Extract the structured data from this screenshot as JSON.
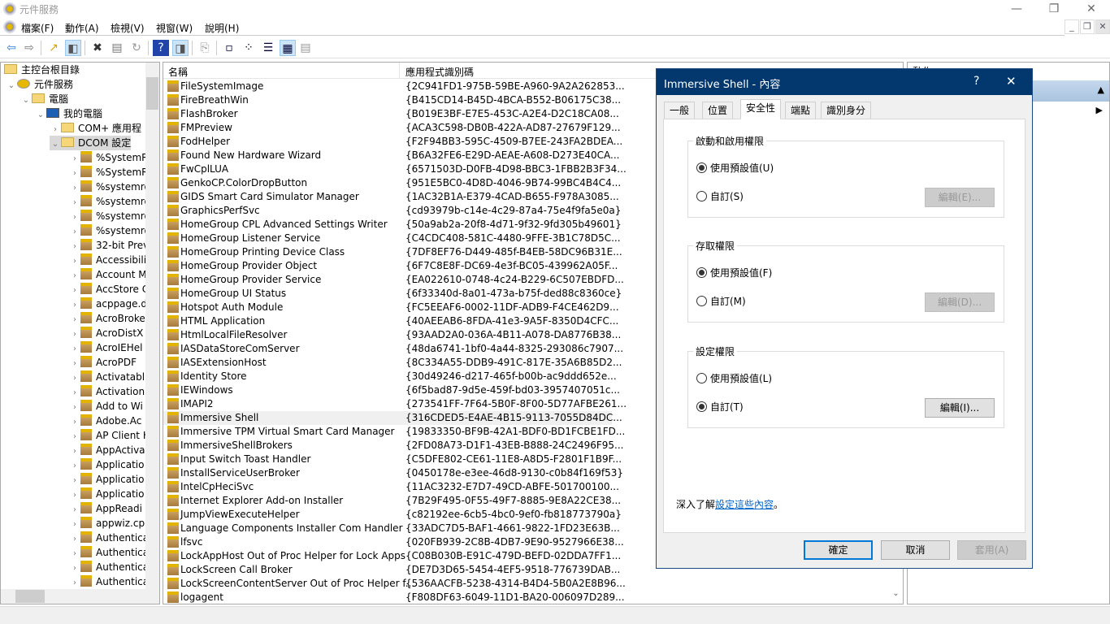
{
  "window": {
    "title": "元件服務",
    "minimize": "—",
    "maximize": "❐",
    "close": "✕"
  },
  "menu": [
    "檔案(F)",
    "動作(A)",
    "檢視(V)",
    "視窗(W)",
    "說明(H)"
  ],
  "mdi": {
    "minimize": "_",
    "restore": "❐",
    "close": "✕"
  },
  "toolbar": [
    {
      "icon": "back-arrow-icon",
      "glyph": "⇦",
      "color": "#2b7cd3"
    },
    {
      "icon": "forward-arrow-icon",
      "glyph": "⇨",
      "color": "#777"
    },
    {
      "icon": "up-folder-icon",
      "glyph": "↗",
      "color": "#d9a400"
    },
    {
      "icon": "show-hide-tree-icon",
      "glyph": "◧",
      "color": "#555",
      "active": true
    },
    {
      "icon": "delete-icon",
      "glyph": "✖",
      "color": "#333"
    },
    {
      "icon": "properties-icon",
      "glyph": "▤",
      "color": "#777"
    },
    {
      "icon": "refresh-icon",
      "glyph": "↻",
      "color": "#999"
    },
    {
      "icon": "help-icon",
      "glyph": "?",
      "color": "#fff",
      "bg": "#2244aa"
    },
    {
      "icon": "show-action-pane-icon",
      "glyph": "◨",
      "color": "#555",
      "active": true
    },
    {
      "icon": "export-icon",
      "glyph": "⎘",
      "color": "#999"
    },
    {
      "icon": "large-icons-view-icon",
      "glyph": "▫",
      "color": "#003"
    },
    {
      "icon": "small-icons-view-icon",
      "glyph": "⁘",
      "color": "#003"
    },
    {
      "icon": "list-view-icon",
      "glyph": "☰",
      "color": "#003"
    },
    {
      "icon": "detail-view-icon",
      "glyph": "▦",
      "color": "#003",
      "active": true
    },
    {
      "icon": "status-view-icon",
      "glyph": "▤",
      "color": "#999"
    }
  ],
  "tree": {
    "root": "主控台根目錄",
    "nodes": [
      {
        "label": "元件服務",
        "level": 1,
        "type": "app",
        "expanded": true
      },
      {
        "label": "電腦",
        "level": 2,
        "type": "folder",
        "expanded": true
      },
      {
        "label": "我的電腦",
        "level": 3,
        "type": "computer",
        "expanded": true
      },
      {
        "label": "COM+ 應用程",
        "level": 4,
        "type": "folder"
      },
      {
        "label": "DCOM 設定",
        "level": 4,
        "type": "folder",
        "expanded": true,
        "selected": true
      }
    ],
    "items": [
      "%SystemR",
      "%SystemR",
      "%systemro",
      "%systemro",
      "%systemro",
      "%systemro",
      "32-bit Prev",
      "Accessibili",
      "Account M",
      "AccStore C",
      "acppage.d",
      "AcroBroke",
      "AcroDistX",
      "AcroIEHel",
      "AcroPDF",
      "Activatabl",
      "Activation",
      "Add to Wi",
      "Adobe.Ac",
      "AP Client H",
      "AppActiva",
      "Applicatio",
      "Applicatio",
      "Applicatio",
      "AppReadi",
      "appwiz.cp",
      "Authentica",
      "Authentica",
      "Authentica",
      "Authentica"
    ]
  },
  "list": {
    "columns": [
      "名稱",
      "應用程式識別碼"
    ],
    "rows": [
      [
        "FileSystemImage",
        "{2C941FD1-975B-59BE-A960-9A2A262853..."
      ],
      [
        "FireBreathWin",
        "{B415CD14-B45D-4BCA-B552-B06175C38..."
      ],
      [
        "FlashBroker",
        "{B019E3BF-E7E5-453C-A2E4-D2C18CA08..."
      ],
      [
        "FMPreview",
        "{ACA3C598-DB0B-422A-AD87-27679F129..."
      ],
      [
        "FodHelper",
        "{F2F94BB3-595C-4509-B7EE-243FA2BDEA..."
      ],
      [
        "Found New Hardware Wizard",
        "{B6A32FE6-E29D-AEAE-A608-D273E40CA..."
      ],
      [
        "FwCplLUA",
        "{6571503D-D0FB-4D98-BBC3-1FBB2B3F34..."
      ],
      [
        "GenkoCP.ColorDropButton",
        "{951E5BC0-4D8D-4046-9B74-99BC4B4C4..."
      ],
      [
        "GIDS Smart Card Simulator Manager",
        "{1AC32B1A-E379-4CAD-B655-F978A3085..."
      ],
      [
        "GraphicsPerfSvc",
        "{cd93979b-c14e-4c29-87a4-75e4f9fa5e0a}"
      ],
      [
        "HomeGroup CPL Advanced Settings Writer",
        "{50a9ab2a-20f8-4d71-9f32-9fd305b49601}"
      ],
      [
        "HomeGroup Listener Service",
        "{C4CDC408-581C-4480-9FFE-3B1C78D5C..."
      ],
      [
        "HomeGroup Printing Device Class",
        "{7DF8EF76-D449-485f-B4EB-58DC96B31E..."
      ],
      [
        "HomeGroup Provider Object",
        "{6F7C8E8F-DC69-4e3f-BC05-439962A05F..."
      ],
      [
        "HomeGroup Provider Service",
        "{EA022610-0748-4c24-B229-6C507EBDFD..."
      ],
      [
        "HomeGroup UI Status",
        "{6f33340d-8a01-473a-b75f-ded88c8360ce}"
      ],
      [
        "Hotspot Auth Module",
        "{FC5EEAF6-0002-11DF-ADB9-F4CE462D9..."
      ],
      [
        "HTML Application",
        "{40AEEAB6-8FDA-41e3-9A5F-8350D4CFC..."
      ],
      [
        "HtmlLocalFileResolver",
        "{93AAD2A0-036A-4B11-A078-DA8776B38..."
      ],
      [
        "IASDataStoreComServer",
        "{48da6741-1bf0-4a44-8325-293086c7907..."
      ],
      [
        "IASExtensionHost",
        "{8C334A55-DDB9-491C-817E-35A6B85D2..."
      ],
      [
        "Identity Store",
        "{30d49246-d217-465f-b00b-ac9ddd652e..."
      ],
      [
        "IEWindows",
        "{6f5bad87-9d5e-459f-bd03-3957407051c..."
      ],
      [
        "IMAPI2",
        "{273541FF-7F64-5B0F-8F00-5D77AFBE261..."
      ],
      [
        "Immersive Shell",
        "{316CDED5-E4AE-4B15-9113-7055D84DC..."
      ],
      [
        "Immersive TPM Virtual Smart Card Manager",
        "{19833350-BF9B-42A1-BDF0-BD1FCBE1FD..."
      ],
      [
        "ImmersiveShellBrokers",
        "{2FD08A73-D1F1-43EB-B888-24C2496F95..."
      ],
      [
        "Input Switch Toast Handler",
        "{C5DFE802-CE61-11E8-A8D5-F2801F1B9F..."
      ],
      [
        "InstallServiceUserBroker",
        "{0450178e-e3ee-46d8-9130-c0b84f169f53}"
      ],
      [
        "IntelCpHeciSvc",
        "{11AC3232-E7D7-49CD-ABFE-501700100..."
      ],
      [
        "Internet Explorer Add-on Installer",
        "{7B29F495-0F55-49F7-8885-9E8A22CE38..."
      ],
      [
        "JumpViewExecuteHelper",
        "{c82192ee-6cb5-4bc0-9ef0-fb818773790a}"
      ],
      [
        "Language Components Installer Com Handler",
        "{33ADC7D5-BAF1-4661-9822-1FD23E63B..."
      ],
      [
        "lfsvc",
        "{020FB939-2C8B-4DB7-9E90-9527966E38..."
      ],
      [
        "LockAppHost Out of Proc Helper for Lock Apps",
        "{C08B030B-E91C-479D-BEFD-02DDA7FF1..."
      ],
      [
        "LockScreen Call Broker",
        "{DE7D3D65-5454-4EF5-9518-776739DAB..."
      ],
      [
        "LockScreenContentServer Out of Proc Helper f...",
        "{536AACFB-5238-4314-B4D4-5B0A2E8B96..."
      ],
      [
        "logagent",
        "{F808DF63-6049-11D1-BA20-006097D289..."
      ]
    ],
    "selected_index": 24
  },
  "dialog": {
    "title": "Immersive Shell - 內容",
    "help": "?",
    "close": "✕",
    "tabs": [
      "一般",
      "位置",
      "安全性",
      "端點",
      "識別身分"
    ],
    "active_tab": 2,
    "groups": [
      {
        "label": "啟動和啟用權限",
        "default_label": "使用預設值(U)",
        "custom_label": "自訂(S)",
        "edit_label": "編輯(E)...",
        "selected": "default",
        "edit_enabled": false
      },
      {
        "label": "存取權限",
        "default_label": "使用預設值(F)",
        "custom_label": "自訂(M)",
        "edit_label": "編輯(D)...",
        "selected": "default",
        "edit_enabled": false
      },
      {
        "label": "設定權限",
        "default_label": "使用預設值(L)",
        "custom_label": "自訂(T)",
        "edit_label": "編輯(I)...",
        "selected": "custom",
        "edit_enabled": true
      }
    ],
    "learn_prefix": "深入了解",
    "learn_link": "設定這些內容",
    "learn_suffix": "。",
    "ok": "確定",
    "cancel": "取消",
    "apply": "套用(A)"
  },
  "actions": {
    "header_partial": "動作"
  }
}
